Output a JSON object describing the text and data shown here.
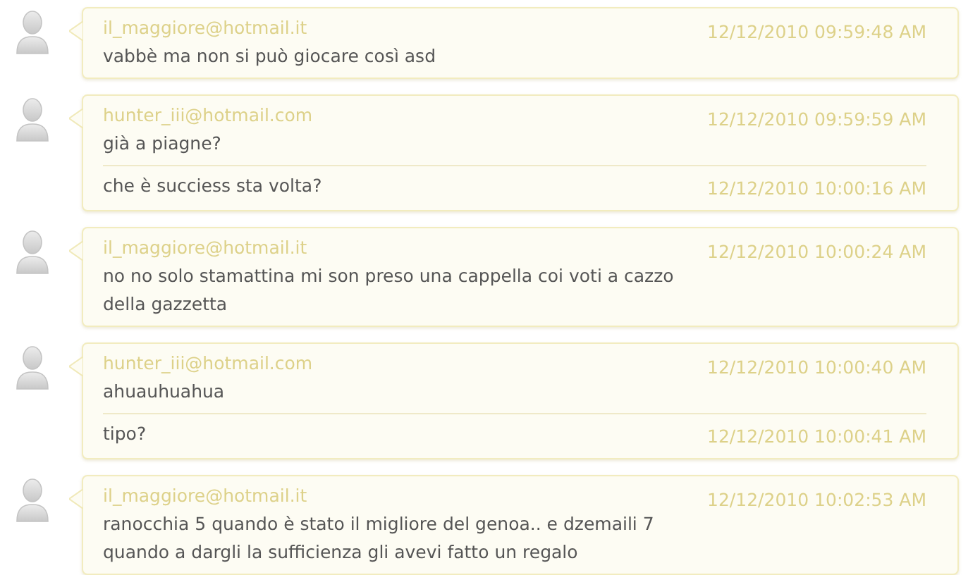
{
  "conversations": [
    {
      "sender": "il_maggiore@hotmail.it",
      "messages": [
        {
          "text": "vabbè ma non si può giocare così asd",
          "time": "12/12/2010 09:59:48 AM"
        }
      ]
    },
    {
      "sender": "hunter_iii@hotmail.com",
      "messages": [
        {
          "text": "già a piagne?",
          "time": "12/12/2010 09:59:59 AM"
        },
        {
          "text": "che è succiess sta volta?",
          "time": "12/12/2010 10:00:16 AM"
        }
      ]
    },
    {
      "sender": "il_maggiore@hotmail.it",
      "messages": [
        {
          "text": "no no solo stamattina mi son preso una cappella coi voti a cazzo della gazzetta",
          "time": "12/12/2010 10:00:24 AM"
        }
      ]
    },
    {
      "sender": "hunter_iii@hotmail.com",
      "messages": [
        {
          "text": "ahuauhuahua",
          "time": "12/12/2010 10:00:40 AM"
        },
        {
          "text": "tipo?",
          "time": "12/12/2010 10:00:41 AM"
        }
      ]
    },
    {
      "sender": "il_maggiore@hotmail.it",
      "messages": [
        {
          "text": "ranocchia 5 quando è stato il migliore del genoa.. e dzemaili 7 quando a dargli la sufficienza gli avevi fatto un regalo",
          "time": "12/12/2010 10:02:53 AM"
        }
      ]
    }
  ]
}
